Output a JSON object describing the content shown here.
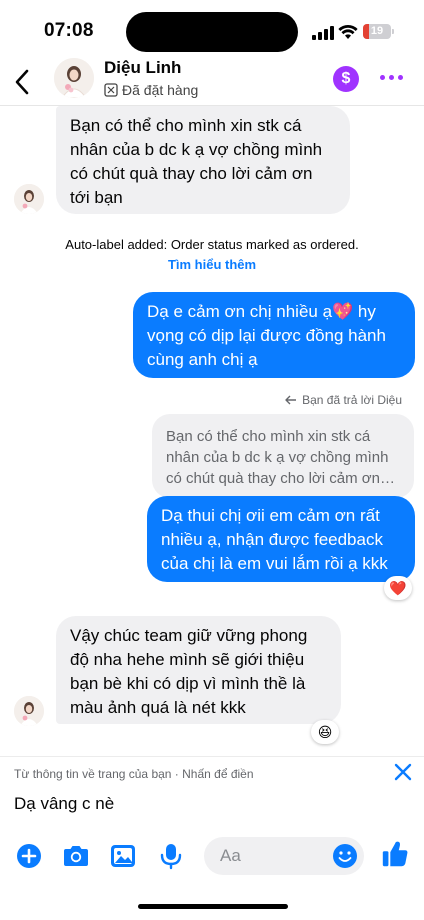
{
  "status_bar": {
    "time": "07:08",
    "battery": "19"
  },
  "header": {
    "contact_name": "Diệu Linh",
    "order_status": "Đã đặt hàng"
  },
  "messages": {
    "m1": "Bạn có thể cho mình xin stk cá nhân của b dc k ạ vợ chồng mình có chút quà thay cho lời cảm ơn tới bạn",
    "system_note": "Auto-label added: Order status marked as ordered.",
    "learn_more": "Tìm hiểu thêm",
    "m2": "Dạ e cảm ơn chị nhiều ạ💖 hy vọng có dịp lại được đồng hành cùng anh chị ạ",
    "reply_label": "Bạn đã trả lời Diệu",
    "quoted": "Bạn có thể cho mình xin stk cá nhân của b dc k ạ vợ chồng mình có chút quà thay cho lời cảm ơn tới bạn",
    "m3": "Dạ thui chị ơii em cảm ơn rất nhiều ạ, nhận được feedback của chị là em vui lắm rồi ạ kkk",
    "m3_reaction": "❤️",
    "m4": "Vậy chúc team giữ vững phong độ nha hehe mình sẽ giới thiệu bạn bè khi có dịp vì mình thề là màu ảnh quá là nét kkk",
    "m4_reaction": "😆"
  },
  "autofill": {
    "hint": "Từ thông tin về trang của bạn · Nhấn để điền",
    "text": "Dạ vâng c nè"
  },
  "composer": {
    "placeholder": "Aa"
  },
  "colors": {
    "accent": "#0a7cff",
    "header_purple": "#a033ff",
    "incoming_bubble": "#f0f0f2"
  },
  "icons": [
    "back-icon",
    "tag-icon",
    "dollar-icon",
    "more-icon",
    "reply-icon",
    "close-icon",
    "plus-icon",
    "camera-icon",
    "gallery-icon",
    "mic-icon",
    "emoji-icon",
    "thumbs-up-icon"
  ]
}
